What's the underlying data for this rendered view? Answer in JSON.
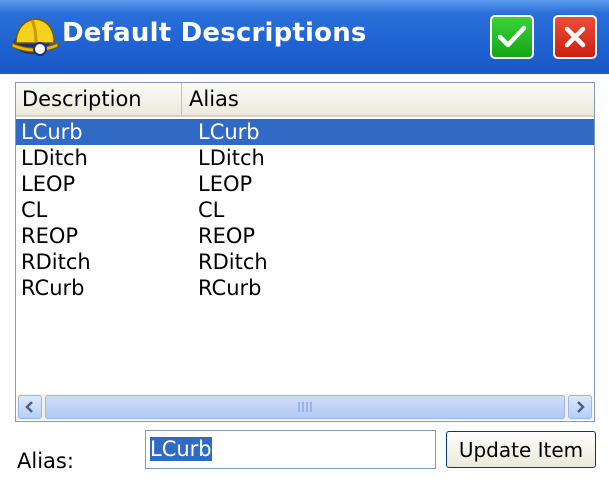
{
  "window": {
    "title": "Default Descriptions",
    "app_icon": "hard-hat-icon",
    "ok_icon": "checkmark-icon",
    "close_icon": "close-icon",
    "colors": {
      "titlebar": "#1f63d3",
      "ok": "#22b022",
      "close": "#e0301c",
      "selection": "#316ac5"
    }
  },
  "list": {
    "columns": [
      "Description",
      "Alias"
    ],
    "rows": [
      {
        "description": "LCurb",
        "alias": "LCurb",
        "selected": true
      },
      {
        "description": "LDitch",
        "alias": "LDitch",
        "selected": false
      },
      {
        "description": "LEOP",
        "alias": "LEOP",
        "selected": false
      },
      {
        "description": "CL",
        "alias": "CL",
        "selected": false
      },
      {
        "description": "REOP",
        "alias": "REOP",
        "selected": false
      },
      {
        "description": "RDitch",
        "alias": "RDitch",
        "selected": false
      },
      {
        "description": "RCurb",
        "alias": "RCurb",
        "selected": false
      }
    ]
  },
  "editor": {
    "alias_label": "Alias:",
    "alias_value": "LCurb",
    "update_button": "Update Item"
  }
}
